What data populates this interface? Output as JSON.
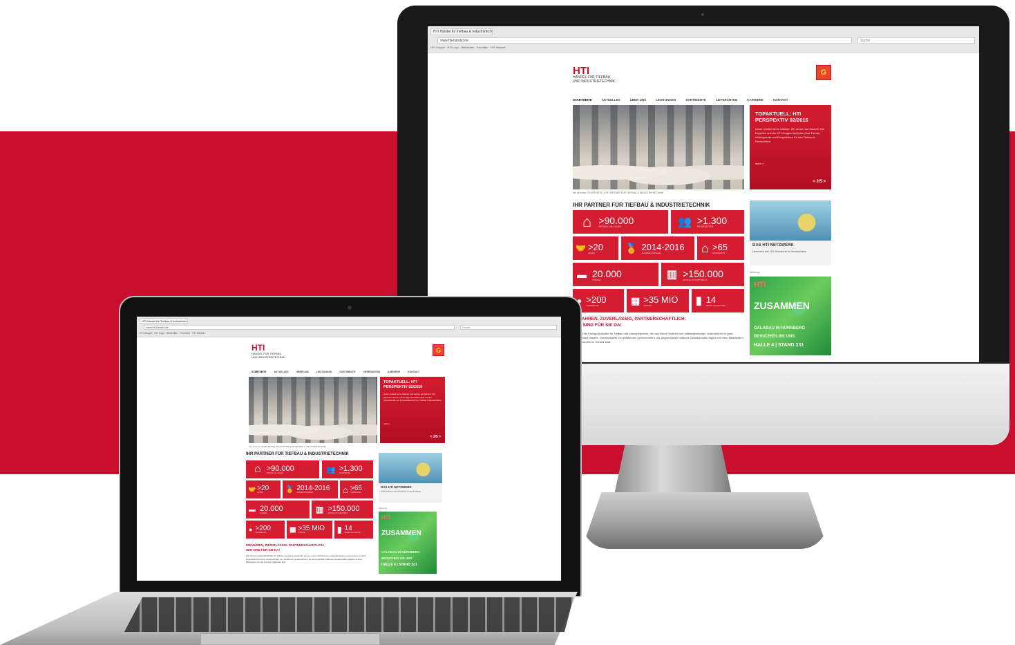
{
  "browser": {
    "tab_title": "HTI Handel für Tiefbau & Industrietechnik",
    "url": "www.hti-handel.de",
    "search_placeholder": "Suche",
    "bookmarks": "HTI Gruppe  ·  HTI Logo  ·  Webseiten  ·  Favoriten  ·  HTI Intranet"
  },
  "site": {
    "logo": "HTI",
    "logo_sub_1": "HANDEL FÜR TIEFBAU",
    "logo_sub_2": "UND INDUSTRIETECHNIK",
    "nav": [
      "STARTSEITE",
      "AKTUELLES",
      "ÜBER UNS",
      "LEISTUNGEN",
      "SORTIMENTE",
      "LIEFERANTEN",
      "KARRIERE",
      "KONTAKT"
    ],
    "promo": {
      "title": "TOPAKTUELL: HTI PERSPEKTIV 02/2016",
      "text": "Unser Umfeld ist im Wandel. Wir setzen auf Zukunft. Die Experten aus der HTI-Gruppe berichten über Trends, Hintergründe und Perspektiven für den Tiefbau in Deutschland.",
      "more": "mehr »",
      "pager": "< 2/5 >"
    },
    "caption": "Sie sind hier: STARTSEITE | IHR PARTNER FÜR TIEFBAU & INDUSTRIETECHNIK",
    "section_title": "IHR PARTNER FÜR TIEFBAU & INDUSTRIETECHNIK",
    "stats": [
      {
        "icon": "house-icon",
        "glyph": "⌂",
        "value": ">90.000",
        "label": "ARTIKEL AM LAGER"
      },
      {
        "icon": "people-icon",
        "glyph": "👥",
        "value": ">1.300",
        "label": "MITARBEITER"
      },
      {
        "icon": "handshake-icon",
        "glyph": "🤝",
        "value": ">20",
        "label": "JAHRE"
      },
      {
        "icon": "award-icon",
        "glyph": "🏅",
        "value": "2014-2016",
        "label": "AUSZEICHNUNGEN"
      },
      {
        "icon": "home-icon",
        "glyph": "⌂",
        "value": ">65",
        "label": "STANDORTE"
      },
      {
        "icon": "truck-icon",
        "glyph": "▬",
        "value": "20.000",
        "label": "KUNDEN"
      },
      {
        "icon": "barcode-icon",
        "glyph": "▥",
        "value": ">150.000",
        "label": "ARTIKEL IM SORTIMENT"
      },
      {
        "icon": "person-icon",
        "glyph": "●",
        "value": ">200",
        "label": "FAHRZEUGE"
      },
      {
        "icon": "calendar-icon",
        "glyph": "▦",
        "value": ">35 MIO",
        "label": "UMSATZ"
      },
      {
        "icon": "warehouse-icon",
        "glyph": "▮",
        "value": "14",
        "label": "GESELLSCHAFTER"
      }
    ],
    "network": {
      "title": "DAS HTI NETZWERK",
      "text": "Übersicht der HTI-Standorte in Deutschland"
    },
    "green": {
      "label": "Werbung",
      "hti": "HTI",
      "head": "ZUSAMMEN",
      "line1": "GALABAU IN NÜRNBERG",
      "line2": "BESUCHEN SIE UNS",
      "line3": "HALLE 4 | STAND 331"
    },
    "body_head_1": "ERFAHREN, ZUVERLÄSSIG, PARTNERSCHAFTLICH:",
    "body_head_2": "WIR SIND FÜR SIE DA!",
    "body_text": "Wir sind ein Fachgroßhändler für Tiefbau und Industrietechnik, der aus einem Verbund von mittelständischen Unternehmen in ganz Deutschland besteht. Gesellschafter von erfahrenen Unternehmern, die als persönlich haftende Gesellschafter täglich mit ihren Mitarbeitern für die Kunden im Einsatz sind."
  },
  "colors": {
    "brand_red": "#c8102e",
    "tile_red": "#d51d32",
    "green": "#2ea34a"
  }
}
